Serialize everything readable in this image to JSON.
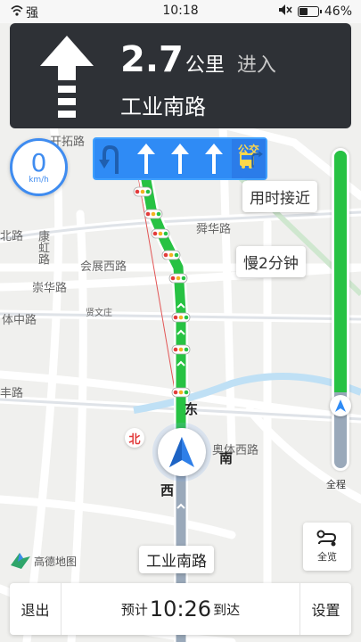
{
  "status_bar": {
    "signal_label": "强",
    "time": "10:18",
    "battery": "46%",
    "battery_level": 0.46
  },
  "navigation": {
    "distance_value": "2.7",
    "distance_unit": "公里",
    "action": "进入",
    "next_road": "工业南路",
    "turn_icon": "straight-arrow-icon"
  },
  "lanes": {
    "items": [
      "u-turn-left",
      "straight",
      "straight",
      "straight",
      "right-turn-bus"
    ],
    "bus_label": "公交"
  },
  "speed": {
    "value": "0",
    "unit": "km/h"
  },
  "bubbles": {
    "time_compare": "用时接近",
    "slower": "慢2分钟"
  },
  "progress": {
    "done_fraction": 0.76,
    "label": "全程"
  },
  "overview": {
    "label": "全览"
  },
  "current_road": "工业南路",
  "compass": {
    "north": "北",
    "east": "东",
    "south": "南",
    "west": "西"
  },
  "map_labels": {
    "road1": "开拓路",
    "road2": "北路",
    "road3": "康虹路",
    "road4": "会展西路",
    "road5": "崇华路",
    "road6": "舜华路",
    "road7": "体中路",
    "road8": "贤文庄",
    "road9": "丰路",
    "road10": "奥体西路"
  },
  "logo": {
    "text": "高德地图"
  },
  "bottom": {
    "exit_label": "退出",
    "eta_prefix": "预计",
    "eta_time": "10:26",
    "eta_suffix": "到达",
    "settings_label": "设置"
  },
  "colors": {
    "route_green": "#27c243",
    "route_gray": "#9aa9ba",
    "accent_blue": "#2f8bf5",
    "nav_card": "#2e3136"
  }
}
